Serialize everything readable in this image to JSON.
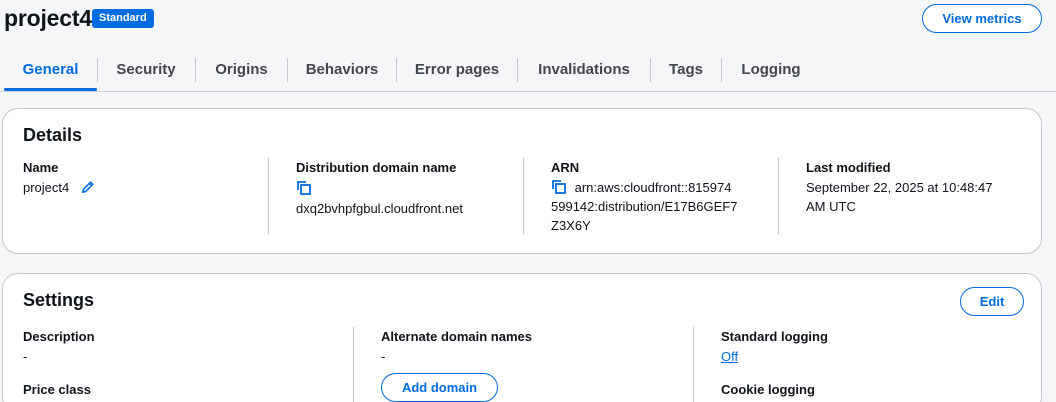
{
  "header": {
    "title": "project4",
    "badge": "Standard",
    "view_metrics_label": "View metrics"
  },
  "tabs": [
    {
      "label": "General",
      "active": true
    },
    {
      "label": "Security"
    },
    {
      "label": "Origins"
    },
    {
      "label": "Behaviors"
    },
    {
      "label": "Error pages"
    },
    {
      "label": "Invalidations"
    },
    {
      "label": "Tags"
    },
    {
      "label": "Logging"
    }
  ],
  "details": {
    "title": "Details",
    "name_label": "Name",
    "name_value": "project4",
    "domain_label": "Distribution domain name",
    "domain_value": "dxq2bvhpfgbul.cloudfront.net",
    "arn_label": "ARN",
    "arn_line1": "arn:aws:cloudfront::815974",
    "arn_line2": "599142:distribution/E17B6GEF7",
    "arn_line3": "Z3X6Y",
    "modified_label": "Last modified",
    "modified_line1": "September 22, 2025 at 10:48:47",
    "modified_line2": "AM UTC"
  },
  "settings": {
    "title": "Settings",
    "edit_label": "Edit",
    "description_label": "Description",
    "description_value": "-",
    "price_class_label": "Price class",
    "alt_domains_label": "Alternate domain names",
    "alt_domains_value": "-",
    "add_domain_label": "Add domain",
    "std_logging_label": "Standard logging",
    "std_logging_value": "Off",
    "cookie_logging_label": "Cookie logging"
  },
  "colors": {
    "accent": "#006ce0",
    "text": "#0f141a",
    "border": "#c6c6cd"
  }
}
